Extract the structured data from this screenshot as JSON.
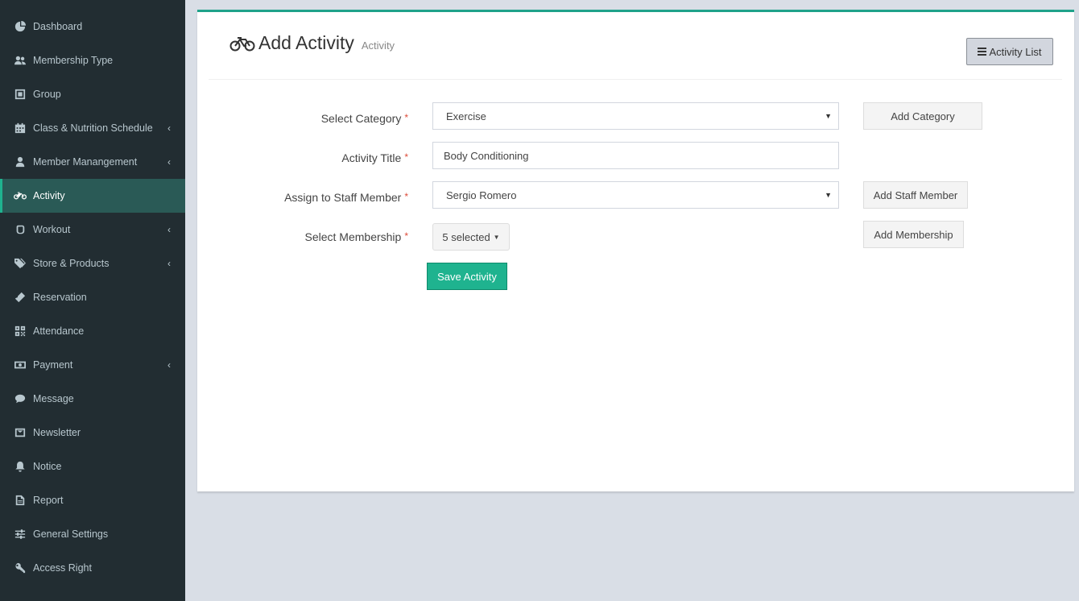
{
  "sidebar": {
    "items": [
      {
        "label": "Dashboard",
        "icon": "dashboard-icon",
        "chevron": false,
        "active": false
      },
      {
        "label": "Membership Type",
        "icon": "users-icon",
        "chevron": false,
        "active": false
      },
      {
        "label": "Group",
        "icon": "group-icon",
        "chevron": false,
        "active": false
      },
      {
        "label": "Class & Nutrition Schedule",
        "icon": "calendar-icon",
        "chevron": true,
        "active": false
      },
      {
        "label": "Member Manangement",
        "icon": "user-icon",
        "chevron": true,
        "active": false
      },
      {
        "label": "Activity",
        "icon": "bicycle-icon",
        "chevron": false,
        "active": true
      },
      {
        "label": "Workout",
        "icon": "fist-icon",
        "chevron": true,
        "active": false
      },
      {
        "label": "Store & Products",
        "icon": "tags-icon",
        "chevron": true,
        "active": false
      },
      {
        "label": "Reservation",
        "icon": "ticket-icon",
        "chevron": false,
        "active": false
      },
      {
        "label": "Attendance",
        "icon": "qrcode-icon",
        "chevron": false,
        "active": false
      },
      {
        "label": "Payment",
        "icon": "money-icon",
        "chevron": true,
        "active": false
      },
      {
        "label": "Message",
        "icon": "comment-icon",
        "chevron": false,
        "active": false
      },
      {
        "label": "Newsletter",
        "icon": "envelope-icon",
        "chevron": false,
        "active": false
      },
      {
        "label": "Notice",
        "icon": "bell-icon",
        "chevron": false,
        "active": false
      },
      {
        "label": "Report",
        "icon": "file-icon",
        "chevron": false,
        "active": false
      },
      {
        "label": "General Settings",
        "icon": "sliders-icon",
        "chevron": false,
        "active": false
      },
      {
        "label": "Access Right",
        "icon": "key-icon",
        "chevron": false,
        "active": false
      }
    ],
    "chevron_glyph": "‹"
  },
  "header": {
    "title": "Add Activity",
    "subtitle": "Activity",
    "list_button": "Activity List"
  },
  "form": {
    "category_label": "Select Category",
    "category_value": "Exercise",
    "add_category": "Add Category",
    "title_label": "Activity Title",
    "title_value": "Body Conditioning",
    "staff_label": "Assign to Staff Member",
    "staff_value": "Sergio Romero",
    "add_staff": "Add Staff Member",
    "membership_label": "Select Membership",
    "membership_value": "5 selected",
    "add_membership": "Add Membership",
    "required_mark": "*",
    "save_button": "Save Activity"
  },
  "colors": {
    "sidebar_bg": "#222d32",
    "active_bg": "#2a5a56",
    "accent": "#1fb38f",
    "required": "#dd4b39"
  }
}
